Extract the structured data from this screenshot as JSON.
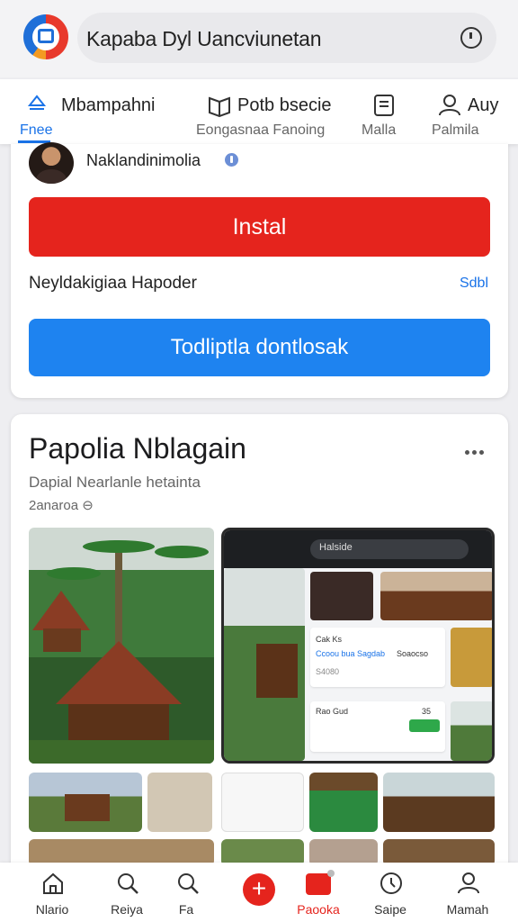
{
  "header": {
    "title": "Kapaba Dyl Uancviunetan",
    "icon": "clock-icon"
  },
  "tabs": [
    {
      "label": "Mbampahni",
      "sub": "Fnee",
      "icon": "recycle-icon",
      "active": true
    },
    {
      "label": "Potb bsecie",
      "sub": "Eongasnaa Fanoing",
      "icon": "book-icon"
    },
    {
      "label": "",
      "sub": "Malla",
      "icon": "tablet-icon"
    },
    {
      "label": "Auy",
      "sub": "Palmila",
      "icon": "person-icon"
    }
  ],
  "app_card": {
    "developer": "Naklandinimolia",
    "install_label": "Instal",
    "info_text": "Neyldakigiaa Hapoder",
    "info_link": "Sdbl",
    "download_label": "Todliptla dontlosak"
  },
  "section": {
    "title": "Papolia Nblagain",
    "subtitle": "Dapial Nearlanle hetainta",
    "date": "2anaroa"
  },
  "gallery": {
    "phone_search": "Halside",
    "card_title": "Cak Ks",
    "card_line": "Ccoou bua Sagdab",
    "card_meta": "Soaocso",
    "card_price": "S4080",
    "card2_title": "Rao Gud",
    "card2_value": "35"
  },
  "colors": {
    "accent_red": "#e5241d",
    "accent_blue": "#1e83f0",
    "link_blue": "#1a73e8"
  },
  "bottom_nav": [
    {
      "label": "Nlario",
      "icon": "home-icon"
    },
    {
      "label": "Reiya",
      "icon": "search-icon"
    },
    {
      "label": "Fa",
      "icon": "search-icon"
    },
    {
      "label": "Paooka",
      "icon": "media-icon",
      "active": true
    },
    {
      "label": "Saipe",
      "icon": "compass-icon"
    },
    {
      "label": "Mamah",
      "icon": "user-icon"
    }
  ]
}
